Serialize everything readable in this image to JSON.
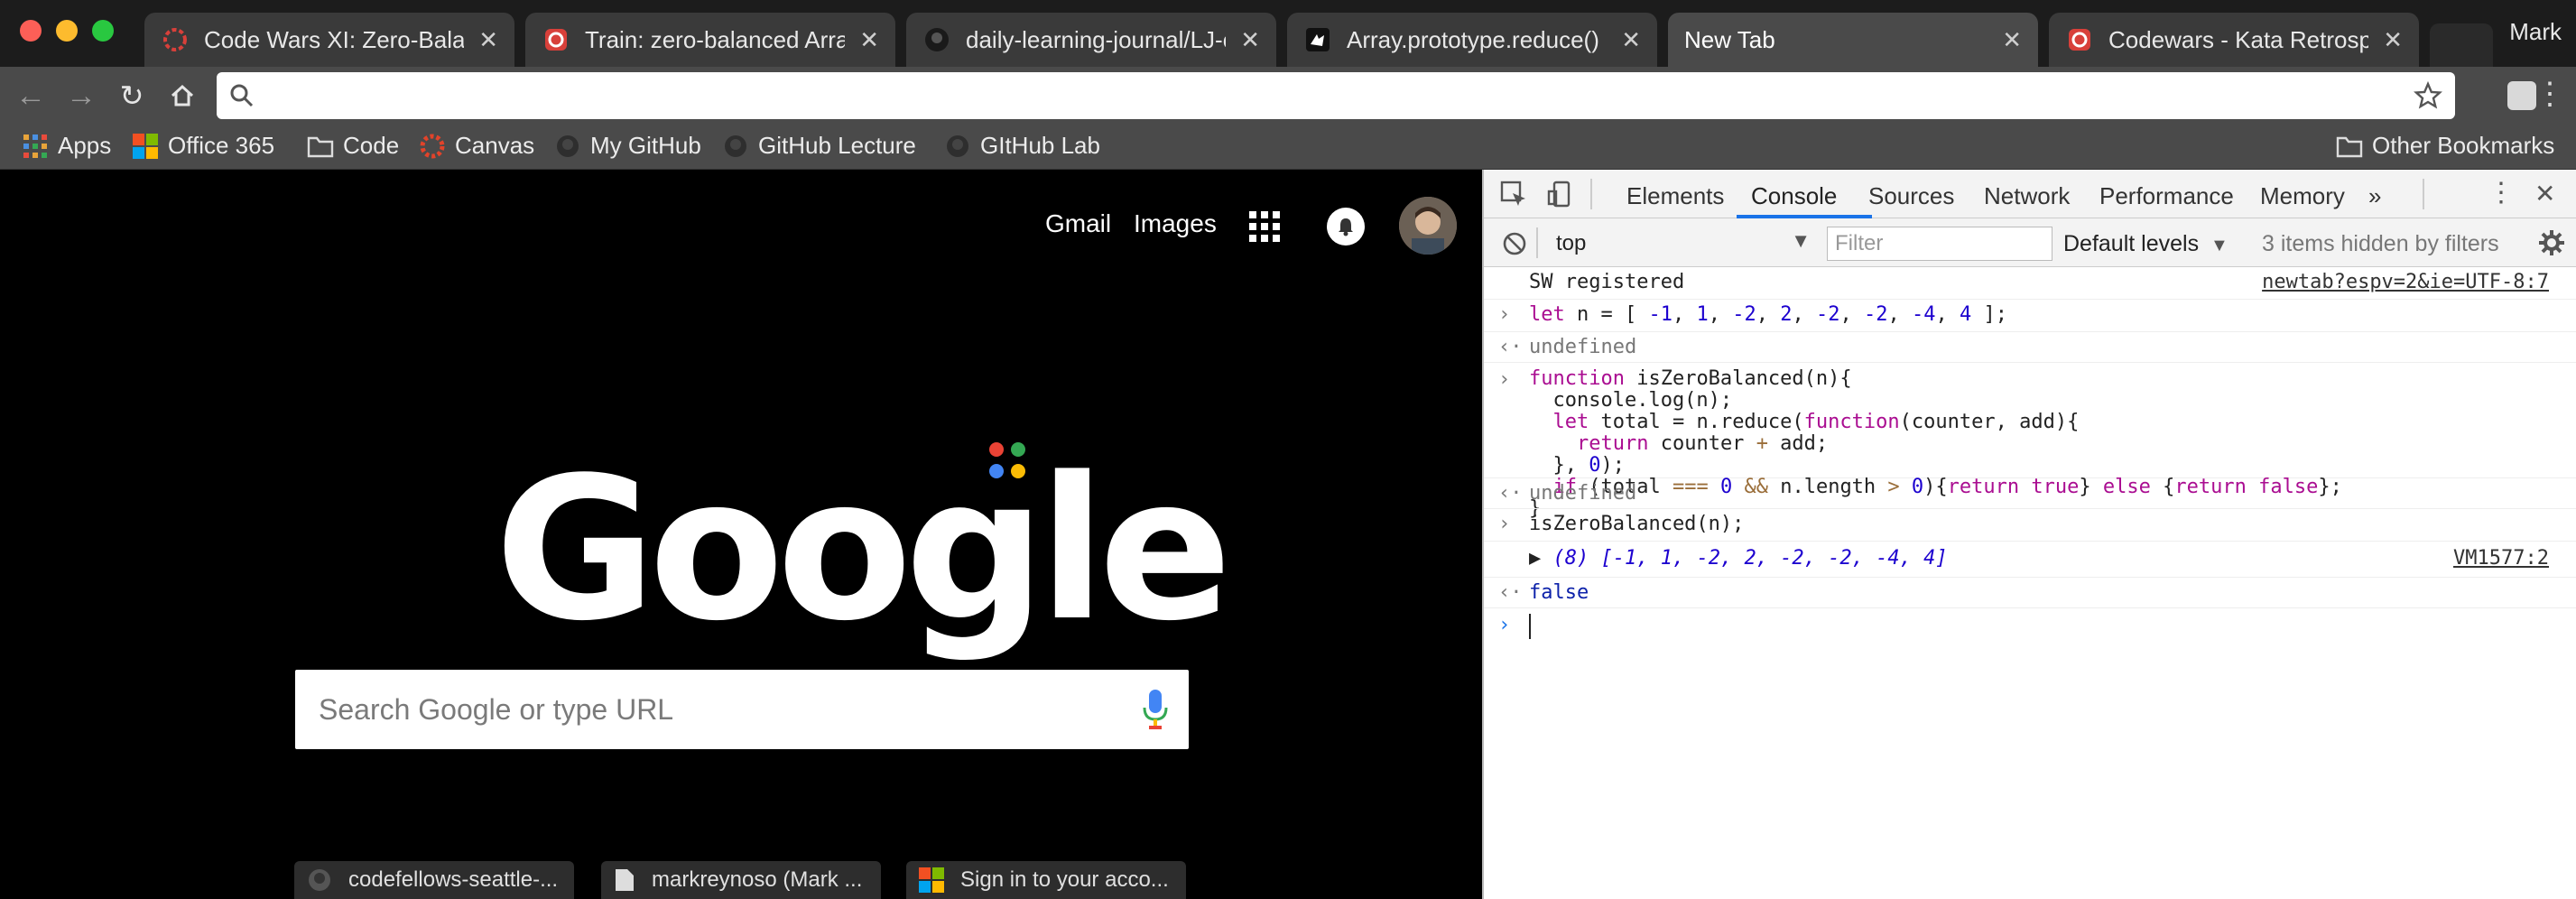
{
  "tabs": [
    {
      "title": "Code Wars XI: Zero-Balance",
      "favicon": "codewars-icon",
      "active": false
    },
    {
      "title": "Train: zero-balanced Array",
      "favicon": "codewars-icon",
      "active": false
    },
    {
      "title": "daily-learning-journal/LJ-cc",
      "favicon": "github-icon",
      "active": false
    },
    {
      "title": "Array.prototype.reduce() -",
      "favicon": "mdn-icon",
      "active": false
    },
    {
      "title": "New Tab",
      "favicon": "",
      "active": true
    },
    {
      "title": "Codewars - Kata Retrospec",
      "favicon": "codewars-icon",
      "active": false
    }
  ],
  "profile_name": "Mark",
  "omnibox": {
    "value": "",
    "placeholder": ""
  },
  "bookmarks": [
    {
      "label": "Apps",
      "icon": "apps-grid-icon"
    },
    {
      "label": "Office 365",
      "icon": "office-icon"
    },
    {
      "label": "Code",
      "icon": "folder-icon"
    },
    {
      "label": "Canvas",
      "icon": "canvas-icon"
    },
    {
      "label": "My GitHub",
      "icon": "github-icon"
    },
    {
      "label": "GitHub Lecture",
      "icon": "github-icon"
    },
    {
      "label": "GItHub Lab",
      "icon": "github-icon"
    }
  ],
  "other_bookmarks": "Other Bookmarks",
  "ntp": {
    "gmail": "Gmail",
    "images": "Images",
    "logo_text": "Google",
    "search_placeholder": "Search Google or type URL",
    "tiles": [
      "codefellows-seattle-...",
      "markreynoso (Mark ...",
      "Sign in to your acco..."
    ]
  },
  "devtools": {
    "tabs": [
      "Elements",
      "Console",
      "Sources",
      "Network",
      "Performance",
      "Memory"
    ],
    "active_tab": "Console",
    "more_tabs": "»",
    "context": "top",
    "filter_placeholder": "Filter",
    "levels": "Default levels",
    "hidden_note": "3 items hidden by filters",
    "console": {
      "sw_msg": "SW registered",
      "sw_src": "newtab?espv=2&ie=UTF-8:7",
      "undefined1": "undefined",
      "undefined2": "undefined",
      "call": "isZeroBalanced(n);",
      "array_len": "(8)",
      "array_values": "[-1, 1, -2, 2, -2, -2, -4, 4]",
      "log_src": "VM1577:2",
      "result": "false"
    }
  },
  "colors": {
    "accent_blue": "#1a73e8",
    "codewars_red": "#d8403a"
  }
}
